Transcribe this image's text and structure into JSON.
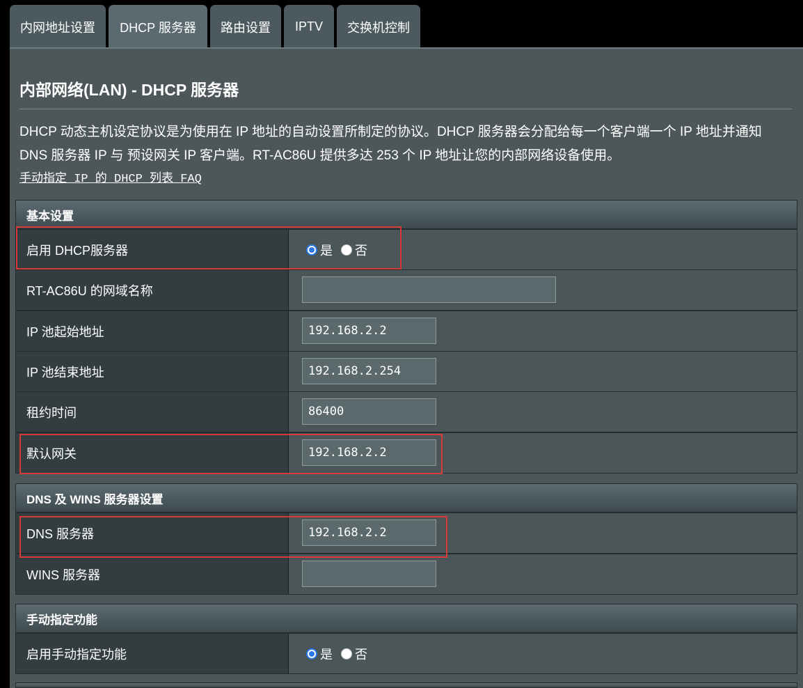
{
  "tabs": [
    "内网地址设置",
    "DHCP 服务器",
    "路由设置",
    "IPTV",
    "交换机控制"
  ],
  "active_tab": "DHCP 服务器",
  "page_title": "内部网络(LAN) - DHCP 服务器",
  "description": "DHCP 动态主机设定协议是为使用在 IP 地址的自动设置所制定的协议。DHCP 服务器会分配给每一个客户端一个 IP 地址并通知 DNS 服务器 IP 与 预设网关 IP 客户端。RT-AC86U 提供多达 253 个 IP 地址让您的内部网络设备使用。",
  "faq_link": "手动指定 IP 的 DHCP 列表 FAQ",
  "basic": {
    "header": "基本设置",
    "enable_dhcp": {
      "label": "启用 DHCP服务器",
      "yes": "是",
      "no": "否",
      "selected": "是"
    },
    "domain_name": {
      "label": "RT-AC86U 的网域名称",
      "value": ""
    },
    "ip_pool_start": {
      "label": "IP 池起始地址",
      "value": "192.168.2.2"
    },
    "ip_pool_end": {
      "label": "IP 池结束地址",
      "value": "192.168.2.254"
    },
    "lease_time": {
      "label": "租约时间",
      "value": "86400"
    },
    "default_gateway": {
      "label": "默认网关",
      "value": "192.168.2.2"
    }
  },
  "dns_wins": {
    "header": "DNS 及 WINS 服务器设置",
    "dns_server": {
      "label": "DNS 服务器",
      "value": "192.168.2.2"
    },
    "wins_server": {
      "label": "WINS 服务器",
      "value": ""
    }
  },
  "manual": {
    "header": "手动指定功能",
    "enable_manual": {
      "label": "启用手动指定功能",
      "yes": "是",
      "no": "否",
      "selected": "是"
    }
  },
  "colors": {
    "highlight": "#d83a3a",
    "radio_accent": "#2a77e6",
    "panel": "#4d5659"
  }
}
